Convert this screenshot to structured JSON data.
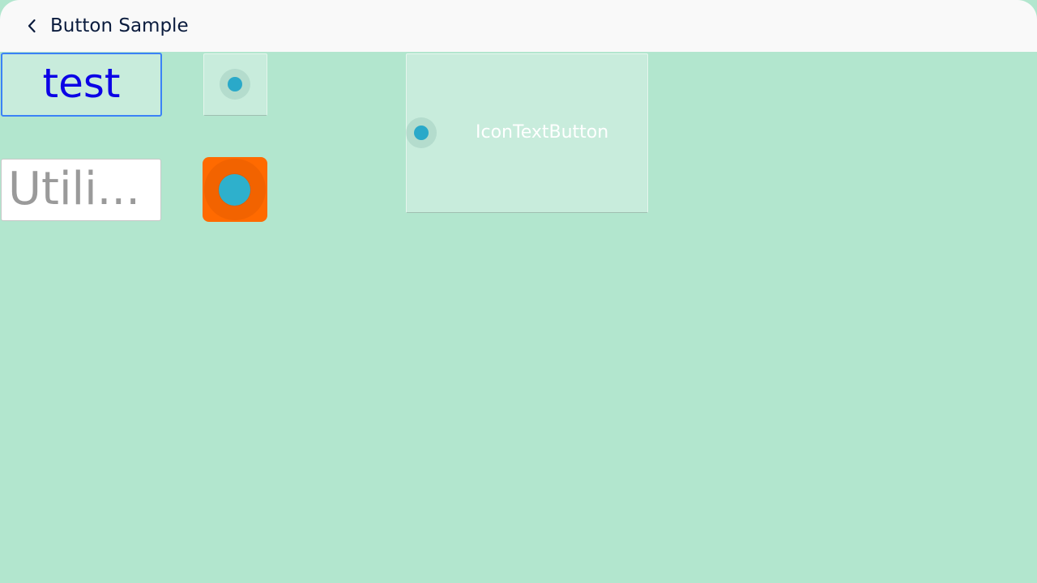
{
  "header": {
    "title": "Button Sample",
    "back_icon": "chevron-left-icon"
  },
  "buttons": {
    "text_button": {
      "label": "test",
      "text_color": "#0b00e6",
      "border_color": "#3b82f6"
    },
    "utility_button": {
      "label": "Utili..."
    },
    "icon_text_button": {
      "label": "IconTextButton",
      "icon": "dot-icon"
    },
    "icon_button": {
      "icon": "dot-icon"
    },
    "orange_icon_button": {
      "icon": "dot-icon",
      "background": "#ff6a00"
    }
  },
  "colors": {
    "page_background": "#b2e6ce",
    "header_background": "#f9f9f9",
    "dot_color": "#2aa9c9"
  }
}
